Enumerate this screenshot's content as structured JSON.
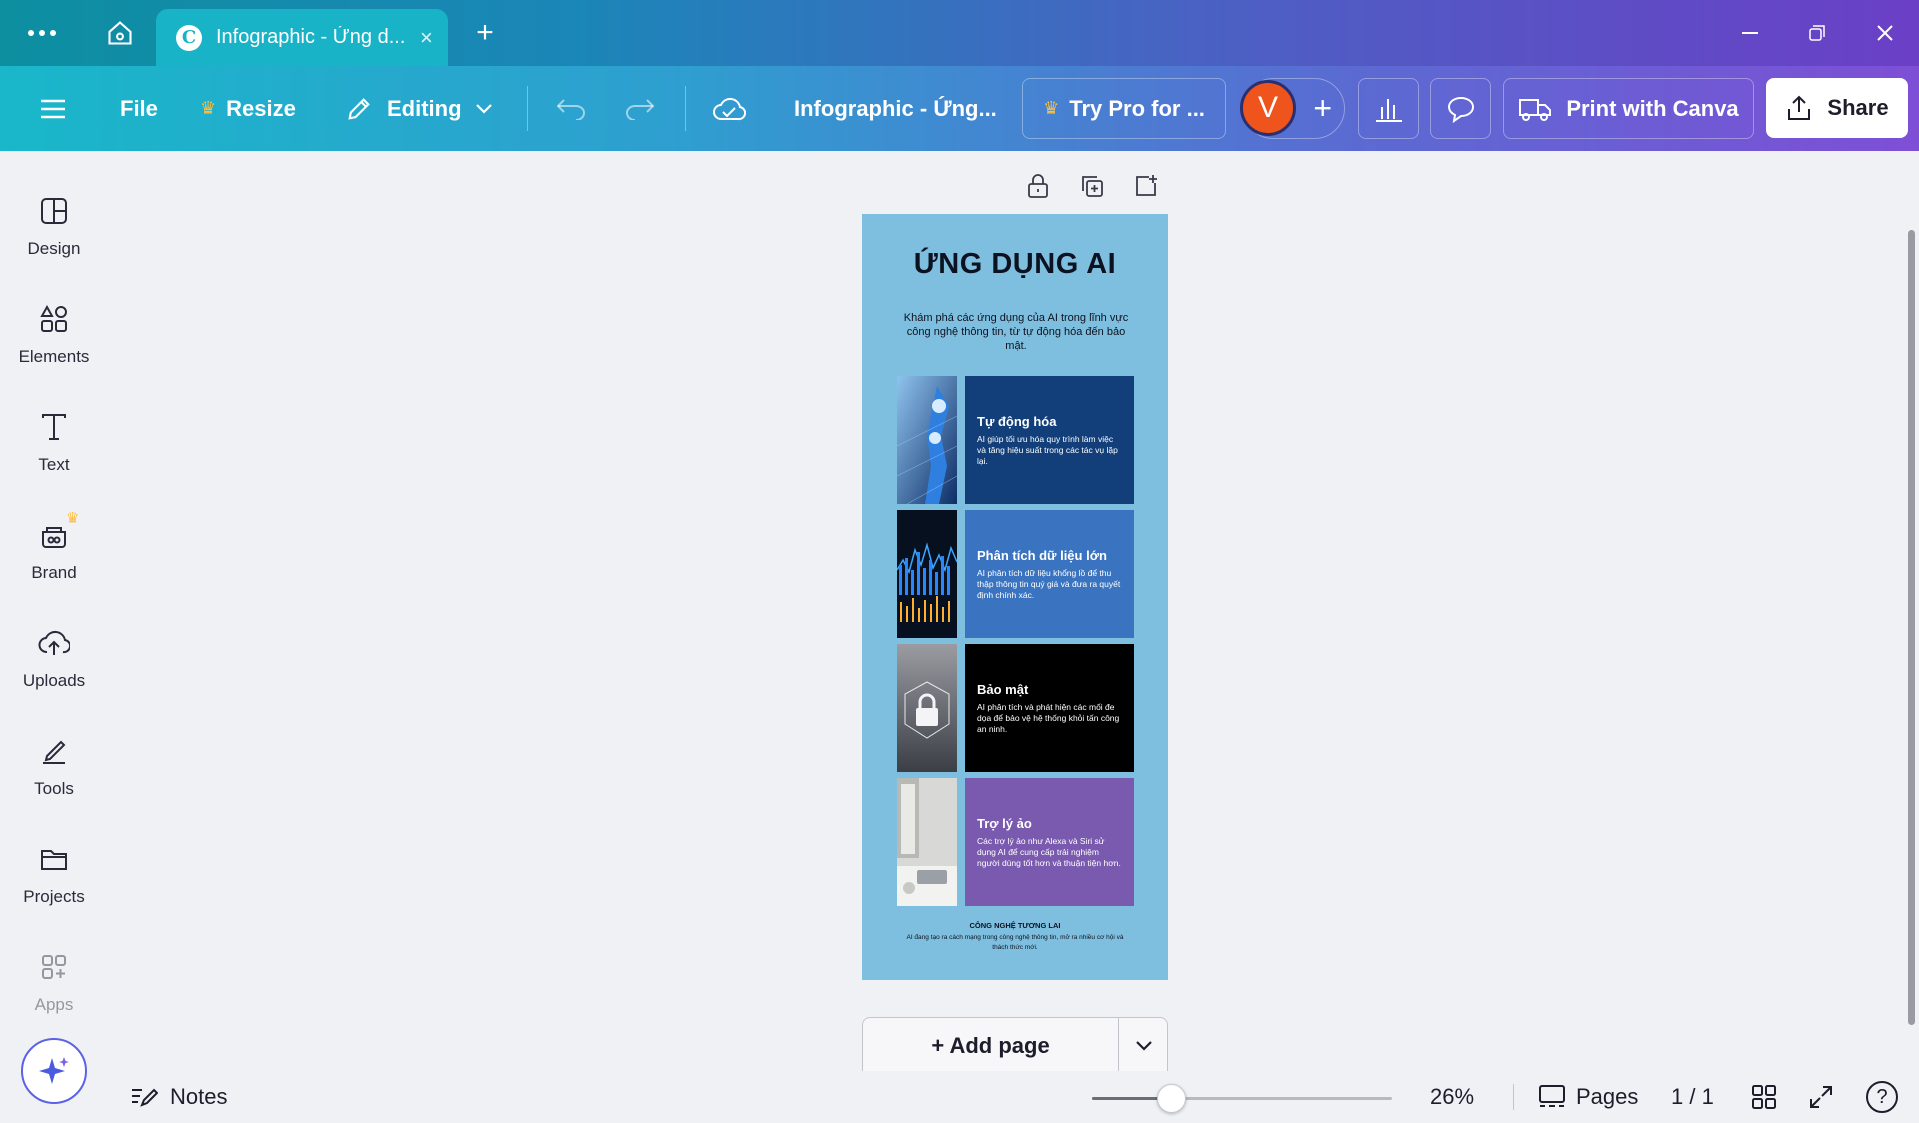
{
  "browser": {
    "tab_title": "Infographic - Ứng d...",
    "logo_letter": "C"
  },
  "toolbar": {
    "file_label": "File",
    "resize_label": "Resize",
    "editing_label": "Editing",
    "doc_title": "Infographic - Ứng...",
    "try_pro_label": "Try Pro for ...",
    "avatar_letter": "V",
    "print_label": "Print with Canva",
    "share_label": "Share"
  },
  "sidebar": {
    "items": [
      {
        "label": "Design"
      },
      {
        "label": "Elements"
      },
      {
        "label": "Text"
      },
      {
        "label": "Brand"
      },
      {
        "label": "Uploads"
      },
      {
        "label": "Tools"
      },
      {
        "label": "Projects"
      },
      {
        "label": "Apps"
      }
    ]
  },
  "page": {
    "title": "ỨNG DỤNG AI",
    "intro": "Khám phá các ứng dụng của AI trong lĩnh vực công nghệ thông tin, từ tự động hóa đến bảo mật.",
    "cards": [
      {
        "title": "Tự động hóa",
        "desc": "AI giúp tối ưu hóa quy trình làm việc và tăng hiệu suất trong các tác vụ lặp lại.",
        "color": "#123f7a"
      },
      {
        "title": "Phân tích dữ liệu lớn",
        "desc": "AI phân tích dữ liệu khổng lồ để thu thập thông tin quý giá và đưa ra quyết định chính xác.",
        "color": "#3a74c0"
      },
      {
        "title": "Bảo mật",
        "desc": "AI phân tích và phát hiện các mối đe dọa để bảo vệ hệ thống khỏi tấn công an ninh.",
        "color": "#000000"
      },
      {
        "title": "Trợ lý ảo",
        "desc": "Các trợ lý ảo như Alexa và Siri sử dụng AI để cung cấp trải nghiệm người dùng tốt hơn và thuận tiện hơn.",
        "color": "#7a5aae"
      }
    ],
    "footer_title": "CÔNG NGHỆ TƯƠNG LAI",
    "footer_text": "AI đang tạo ra cách mạng trong công nghệ thông tin, mở ra nhiều cơ hội và thách thức mới."
  },
  "add_page_label": "+ Add page",
  "bottom": {
    "notes_label": "Notes",
    "zoom_label": "26%",
    "zoom_value": 26,
    "pages_label": "Pages",
    "page_count": "1 / 1",
    "help_label": "?"
  },
  "colors": {
    "page_bg": "#7ebfdf",
    "avatar": "#f0541d",
    "crown": "#ffbe3d"
  }
}
